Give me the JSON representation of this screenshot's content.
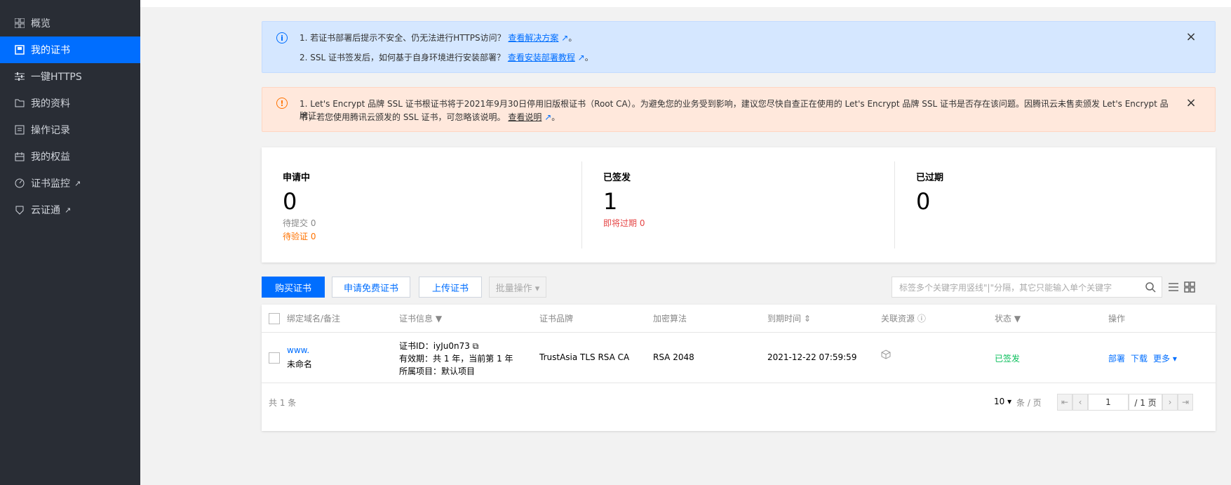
{
  "sidebar": {
    "items": [
      {
        "label": "概览",
        "icon": "grid-icon",
        "active": false
      },
      {
        "label": "我的证书",
        "icon": "certificate-icon",
        "active": true
      },
      {
        "label": "一键HTTPS",
        "icon": "sliders-icon",
        "active": false
      },
      {
        "label": "我的资料",
        "icon": "folder-icon",
        "active": false
      },
      {
        "label": "操作记录",
        "icon": "log-icon",
        "active": false
      },
      {
        "label": "我的权益",
        "icon": "calendar-icon",
        "active": false
      },
      {
        "label": "证书监控",
        "icon": "monitor-icon",
        "active": false,
        "external": true
      },
      {
        "label": "云证通",
        "icon": "shield-icon",
        "active": false,
        "external": true
      }
    ]
  },
  "notices": {
    "info": {
      "line1_text": "1. 若证书部署后提示不安全、仍无法进行HTTPS访问？",
      "line1_link": "查看解决方案",
      "line2_text": "2. SSL 证书签发后，如何基于自身环境进行安装部署？",
      "line2_link": "查看安装部署教程",
      "period": "。"
    },
    "warn": {
      "line1_text": "1. Let's Encrypt 品牌 SSL 证书根证书将于2021年9月30日停用旧版根证书（Root CA）。为避免您的业务受到影响，建议您尽快自查正在使用的 Let's Encrypt 品牌 SSL 证书是否存在该问题。因腾讯云未售卖颁发 Let's Encrypt 品牌证",
      "line2_text": "书，若您使用腾讯云颁发的 SSL 证书，可忽略该说明。",
      "line2_link": "查看说明",
      "period": "。"
    },
    "close_glyph": "×"
  },
  "stats": {
    "applying": {
      "title": "申请中",
      "count": "0",
      "pending_submit": "待提交 0",
      "pending_verify": "待验证 0"
    },
    "issued": {
      "title": "已签发",
      "count": "1",
      "expiring": "即将过期 0"
    },
    "expired": {
      "title": "已过期",
      "count": "0"
    }
  },
  "toolbar": {
    "buy_label": "购买证书",
    "free_label": "申请免费证书",
    "upload_label": "上传证书",
    "batch_label": "批量操作 ▾",
    "search_placeholder": "标签多个关键字用竖线\"|\"分隔，其它只能输入单个关键字"
  },
  "table": {
    "columns": [
      "绑定域名/备注",
      "证书信息",
      "证书品牌",
      "加密算法",
      "到期时间",
      "关联资源",
      "状态",
      "操作"
    ],
    "rows": [
      {
        "domain": "www.",
        "remark": "未命名",
        "cert_id": "证书ID：iyJu0n73",
        "validity": "有效期：共 1 年，当前第 1 年",
        "project": "所属项目：默认项目",
        "brand": "TrustAsia TLS RSA CA",
        "algorithm": "RSA 2048",
        "expire": "2021-12-22 07:59:59",
        "status": "已签发",
        "actions": {
          "deploy": "部署",
          "download": "下载",
          "more": "更多 ▾"
        }
      }
    ],
    "total": "共 1 条",
    "page_size": "10 ▾",
    "per_page_unit": "条 / 页",
    "page_input": "1",
    "page_total": "/ 1 页"
  },
  "colors": {
    "accent": "#006eff",
    "sidebar_bg": "#292d35",
    "success": "#0abf5b",
    "warning": "#ff7200",
    "danger": "#e54545"
  }
}
